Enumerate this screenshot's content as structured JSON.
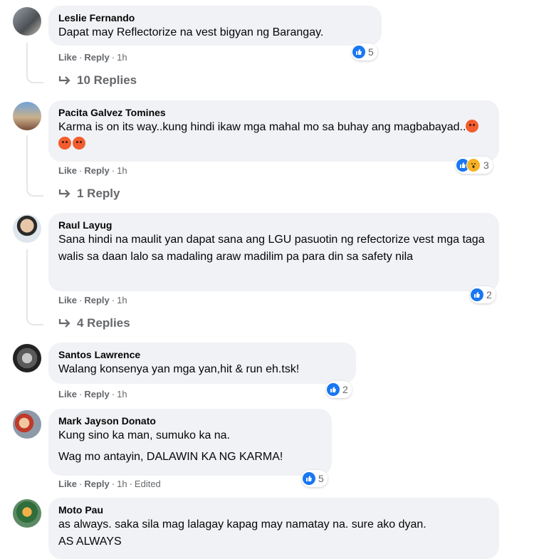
{
  "comments": [
    {
      "author": "Leslie Fernando",
      "lines": [
        "Dapat may Reflectorize na vest bigyan ng Barangay."
      ],
      "like": "Like",
      "reply": "Reply",
      "time": "1h",
      "reaction_count": "5",
      "replies": "10 Replies"
    },
    {
      "author": "Pacita Galvez Tomines",
      "lines": [
        "Karma is on its way..kung hindi ikaw mga mahal mo sa buhay ang magbabayad.."
      ],
      "emoji_count": 3,
      "like": "Like",
      "reply": "Reply",
      "time": "1h",
      "reaction_count": "3",
      "replies": "1 Reply"
    },
    {
      "author": "Raul Layug",
      "lines": [
        "Sana hindi na maulit yan dapat sana ang LGU pasuotin ng refectorize vest mga taga walis sa daan lalo sa madaling araw madilim pa para din sa safety nila"
      ],
      "like": "Like",
      "reply": "Reply",
      "time": "1h",
      "reaction_count": "2",
      "replies": "4 Replies"
    },
    {
      "author": "Santos Lawrence",
      "lines": [
        "Walang konsenya yan mga yan,hit & run eh.tsk!"
      ],
      "like": "Like",
      "reply": "Reply",
      "time": "1h",
      "reaction_count": "2"
    },
    {
      "author": "Mark Jayson Donato",
      "lines": [
        "Kung sino ka man, sumuko ka na.",
        "Wag mo antayin, DALAWIN KA NG KARMA!"
      ],
      "like": "Like",
      "reply": "Reply",
      "time": "1h",
      "edited": "Edited",
      "reaction_count": "5"
    },
    {
      "author": "Moto Pau",
      "lines": [
        "as always. saka sila mag lalagay kapag may namatay na. sure ako dyan.",
        "AS ALWAYS"
      ]
    }
  ],
  "sep": "·",
  "colors": {
    "bubble": "#f0f2f5",
    "meta": "#65676b",
    "like_blue": "#1877f2",
    "angry": "#f35c2e",
    "wow": "#f7b125"
  },
  "icons": {
    "reply_arrow": "reply-arrow-icon",
    "like": "like-reaction-icon",
    "wow": "wow-reaction-icon",
    "angry": "angry-emoji"
  }
}
